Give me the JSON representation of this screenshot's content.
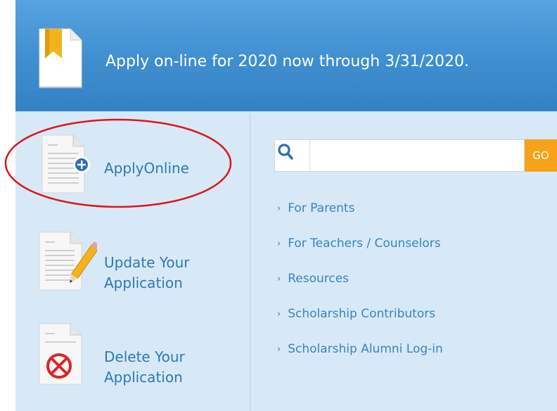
{
  "banner": {
    "text": "Apply on-line for 2020 now through 3/31/2020."
  },
  "actions": [
    {
      "label": "ApplyOnline",
      "badge": "plus-circle-icon"
    },
    {
      "label_line1": "Update Your",
      "label_line2": "Application",
      "badge": "pencil-icon"
    },
    {
      "label_line1": "Delete Your",
      "label_line2": "Application",
      "badge": "delete-x-icon"
    }
  ],
  "search": {
    "placeholder": "",
    "value": "",
    "go_label": "GO"
  },
  "links": [
    {
      "label": "For Parents"
    },
    {
      "label": "For Teachers / Counselors"
    },
    {
      "label": "Resources"
    },
    {
      "label": "Scholarship Contributors"
    },
    {
      "label": "Scholarship Alumni Log-in"
    }
  ],
  "link_marker": "›",
  "colors": {
    "banner": "#3f8ed0",
    "panel": "#d7e9f6",
    "link": "#3a82c0",
    "go_button": "#f7a21b",
    "highlight_ellipse": "#e0141b"
  }
}
